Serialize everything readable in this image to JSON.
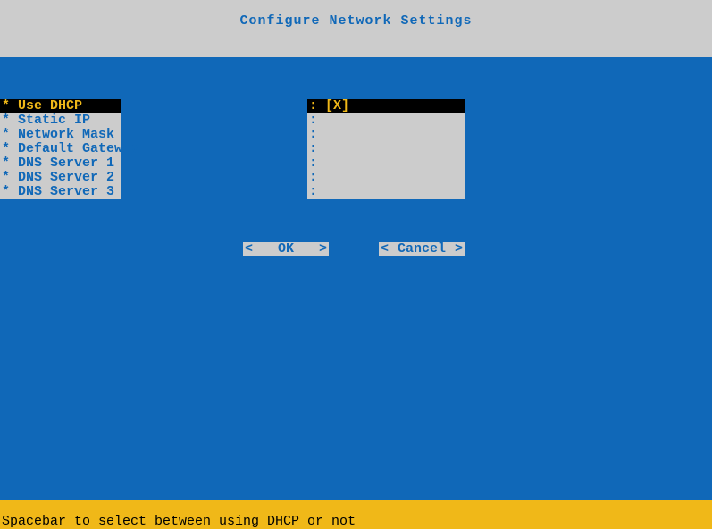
{
  "header": {
    "title": "Configure Network Settings"
  },
  "menu": {
    "items": [
      {
        "label": "Use DHCP",
        "selected": true
      },
      {
        "label": "Static IP",
        "selected": false
      },
      {
        "label": "Network Mask",
        "selected": false
      },
      {
        "label": "Default Gateway",
        "selected": false
      },
      {
        "label": "DNS Server 1",
        "selected": false
      },
      {
        "label": "DNS Server 2",
        "selected": false
      },
      {
        "label": "DNS Server 3",
        "selected": false
      }
    ]
  },
  "values": {
    "items": [
      {
        "value": "[X]",
        "selected": true
      },
      {
        "value": "",
        "selected": false
      },
      {
        "value": "",
        "selected": false
      },
      {
        "value": "",
        "selected": false
      },
      {
        "value": "",
        "selected": false
      },
      {
        "value": "",
        "selected": false
      },
      {
        "value": "",
        "selected": false
      }
    ]
  },
  "buttons": {
    "ok": "OK",
    "cancel": "Cancel"
  },
  "footer": {
    "hint": "Spacebar to select between using DHCP or not"
  },
  "glyphs": {
    "bullet": "*",
    "colon": ":",
    "chev_left": "<",
    "chev_right": ">"
  }
}
